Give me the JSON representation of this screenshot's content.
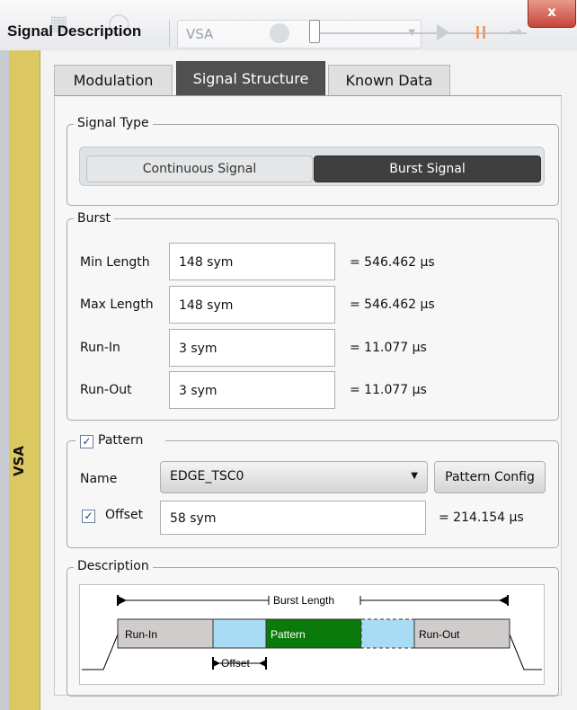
{
  "window": {
    "title": "Signal Description",
    "app_selector": "VSA",
    "close_label": "x"
  },
  "side_tab": {
    "label": "VSA"
  },
  "tabs": [
    {
      "label": "Modulation",
      "active": false
    },
    {
      "label": "Signal Structure",
      "active": true
    },
    {
      "label": "Known Data",
      "active": false
    }
  ],
  "signal_type": {
    "group_title": "Signal Type",
    "options": [
      "Continuous Signal",
      "Burst Signal"
    ],
    "selected": "Burst Signal"
  },
  "burst": {
    "group_title": "Burst",
    "rows": [
      {
        "label": "Min Length",
        "value": "148 sym",
        "readout": "= 546.462 µs"
      },
      {
        "label": "Max Length",
        "value": "148 sym",
        "readout": "= 546.462 µs"
      },
      {
        "label": "Run-In",
        "value": "3 sym",
        "readout": "= 11.077 µs"
      },
      {
        "label": "Run-Out",
        "value": "3 sym",
        "readout": "= 11.077 µs"
      }
    ]
  },
  "pattern": {
    "group_title": "Pattern",
    "enabled": true,
    "checkbox_mark": "✓",
    "name_label": "Name",
    "name_value": "EDGE_TSC0",
    "config_button": "Pattern Config",
    "offset_label": "Offset",
    "offset_enabled": true,
    "offset_value": "58 sym",
    "offset_readout": "= 214.154 µs"
  },
  "description": {
    "group_title": "Description",
    "diagram": {
      "burst_length_label": "Burst Length",
      "run_in_label": "Run-In",
      "pattern_label": "Pattern",
      "run_out_label": "Run-Out",
      "offset_label": "Offset"
    }
  },
  "colors": {
    "side_tab": "#dcc860",
    "active_tab": "#505050",
    "pattern_green": "#0a7a0a",
    "segment_blue": "#a8dcf5",
    "segment_gray": "#d0cccc"
  }
}
